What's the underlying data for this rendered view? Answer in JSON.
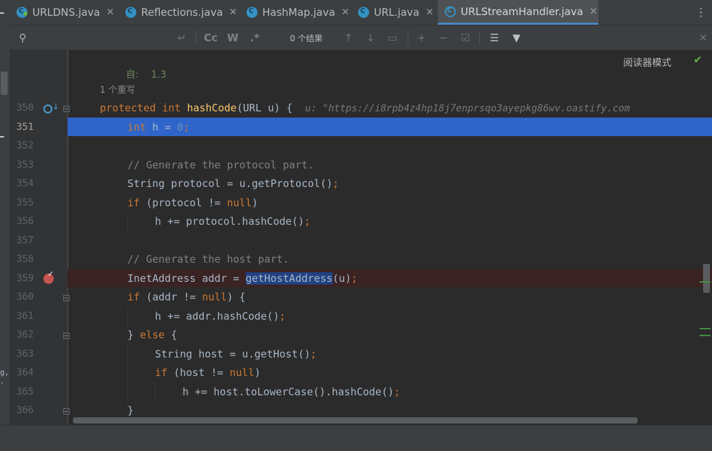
{
  "tabs": [
    {
      "name": "URLDNS.java",
      "close": "✕"
    },
    {
      "name": "Reflections.java",
      "close": "✕"
    },
    {
      "name": "HashMap.java",
      "close": "✕"
    },
    {
      "name": "URL.java",
      "close": "✕"
    },
    {
      "name": "URLStreamHandler.java",
      "close": "✕"
    }
  ],
  "search": {
    "result": "0 个结果"
  },
  "reader_mode": "阅读器模式",
  "doc": {
    "since_label": "自:",
    "since_value": "1.3",
    "overrides": "1 个重写"
  },
  "hint": "u: \"https://i8rpb4z4hp18j7enprsqo3ayepkg86wv.oastify.com",
  "left_fragment": "g, .",
  "line_numbers": [
    "350",
    "351",
    "352",
    "353",
    "354",
    "355",
    "356",
    "357",
    "358",
    "359",
    "360",
    "361",
    "362",
    "363",
    "364",
    "365",
    "366"
  ],
  "code": {
    "l350": {
      "kw1": "protected",
      "kw2": "int",
      "fn": "hashCode",
      "rest": "(URL u) {"
    },
    "l351": {
      "kw": "int",
      "rest": " h = ",
      "num": "0",
      "semi": ";"
    },
    "l353": {
      "comment": "// Generate the protocol part."
    },
    "l354": {
      "text": "String protocol = u.getProtocol()",
      "semi": ";"
    },
    "l355": {
      "kw": "if",
      "mid": " (protocol != ",
      "kw2": "null",
      "end": ")"
    },
    "l356": {
      "text": "h += protocol.hashCode()",
      "semi": ";"
    },
    "l358": {
      "comment": "// Generate the host part."
    },
    "l359": {
      "pre": "InetAddress addr = ",
      "sel": "getHostAddress",
      "post": "(u)",
      "semi": ";"
    },
    "l360": {
      "kw": "if",
      "mid": " (addr != ",
      "kw2": "null",
      "end": ") {"
    },
    "l361": {
      "text": "h += addr.hashCode()",
      "semi": ";"
    },
    "l362": {
      "pre": "} ",
      "kw": "else",
      "end": " {"
    },
    "l363": {
      "text": "String host = u.getHost()",
      "semi": ";"
    },
    "l364": {
      "kw": "if",
      "mid": " (host != ",
      "kw2": "null",
      "end": ")"
    },
    "l365": {
      "text": "h += host.toLowerCase().hashCode()",
      "semi": ";"
    },
    "l366": {
      "text": "}"
    }
  },
  "colors": {
    "accent": "#4a88c7",
    "selection": "#2f65ca",
    "breakpoint_line": "#3a2323",
    "keyword": "#cc7832",
    "function": "#ffc66d"
  }
}
